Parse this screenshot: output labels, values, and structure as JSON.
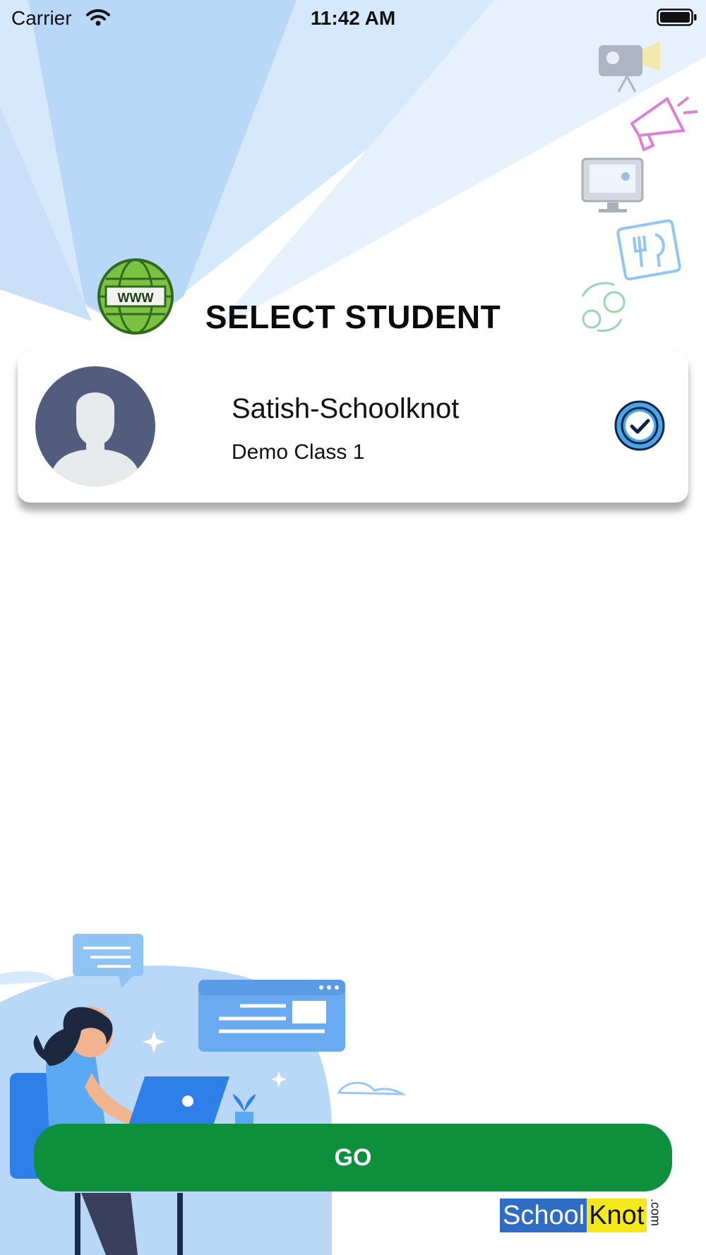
{
  "status_bar": {
    "carrier": "Carrier",
    "time": "11:42 AM",
    "wifi_icon": "wifi-icon",
    "battery_icon": "battery-full-icon"
  },
  "header": {
    "title": "SELECT STUDENT",
    "globe_icon_text": "WWW"
  },
  "student_card": {
    "name": "Satish-Schoolknot",
    "class": "Demo Class 1",
    "avatar_icon": "default-avatar-icon",
    "selected": true,
    "check_icon": "check-circle-icon"
  },
  "actions": {
    "go_label": "GO"
  },
  "branding": {
    "logo_part_1": "School",
    "logo_part_2": "Knot",
    "logo_part_3": ".com"
  },
  "colors": {
    "primary_green": "#0e8f3b",
    "light_blue": "#cfe4fa",
    "accent_blue": "#4aa4ea",
    "logo_blue": "#2f6cc3",
    "logo_yellow": "#f3e81b",
    "avatar_bg": "#525d7e"
  }
}
